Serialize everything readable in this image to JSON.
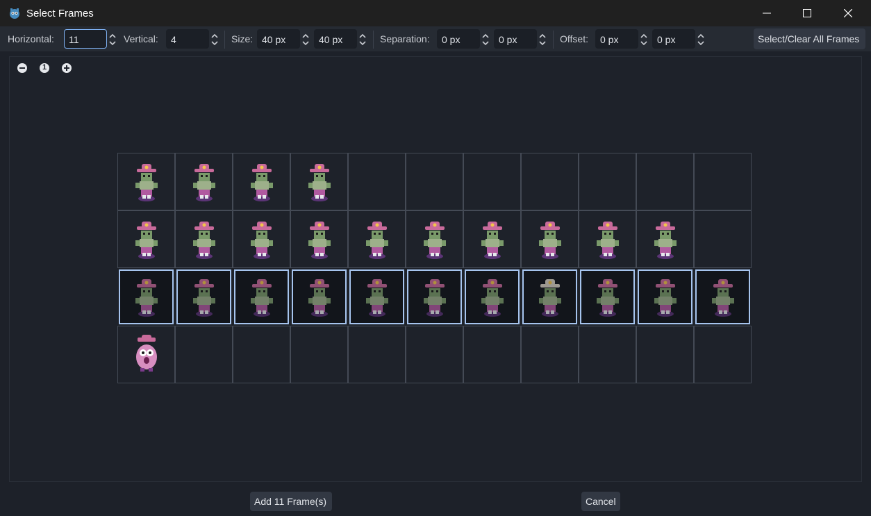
{
  "window": {
    "title": "Select Frames"
  },
  "toolbar": {
    "horizontal_label": "Horizontal:",
    "horizontal_value": "11",
    "vertical_label": "Vertical:",
    "vertical_value": "4",
    "size_label": "Size:",
    "size_x": "40 px",
    "size_y": "40 px",
    "separation_label": "Separation:",
    "separation_x": "0 px",
    "separation_y": "0 px",
    "offset_label": "Offset:",
    "offset_x": "0 px",
    "offset_y": "0 px",
    "select_all_label": "Select/Clear All Frames"
  },
  "zoom": {
    "reset_label": "1"
  },
  "grid": {
    "columns": 11,
    "rows": 4,
    "selected_row": 3,
    "frames_per_row": [
      4,
      10,
      11,
      1
    ]
  },
  "footer": {
    "add_label": "Add 11 Frame(s)",
    "cancel_label": "Cancel"
  },
  "colors": {
    "accent": "#a6c4ee",
    "sprite_hat": "#c86a9a",
    "sprite_body": "#7a9a6a",
    "sprite_shadow": "#6a3a8a"
  }
}
